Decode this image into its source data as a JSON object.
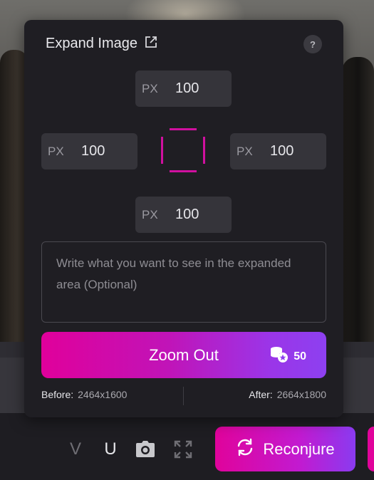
{
  "modal": {
    "title": "Expand Image",
    "help_label": "?",
    "top": {
      "unit": "PX",
      "value": "100"
    },
    "left": {
      "unit": "PX",
      "value": "100"
    },
    "right": {
      "unit": "PX",
      "value": "100"
    },
    "bottom": {
      "unit": "PX",
      "value": "100"
    },
    "prompt_placeholder": "Write what you want to see in the expanded area (Optional)",
    "zoom_button": {
      "label": "Zoom Out",
      "credits": "50"
    },
    "before": {
      "label": "Before:",
      "value": "2464x1600"
    },
    "after": {
      "label": "After:",
      "value": "2664x1800"
    }
  },
  "toolbar": {
    "v_label": "V",
    "u_label": "U",
    "reconjure_label": "Reconjure"
  },
  "colors": {
    "accent_pink": "#e0039b",
    "accent_purple": "#8d40f0",
    "panel_bg": "#1f1e23",
    "field_bg": "#35343a"
  }
}
